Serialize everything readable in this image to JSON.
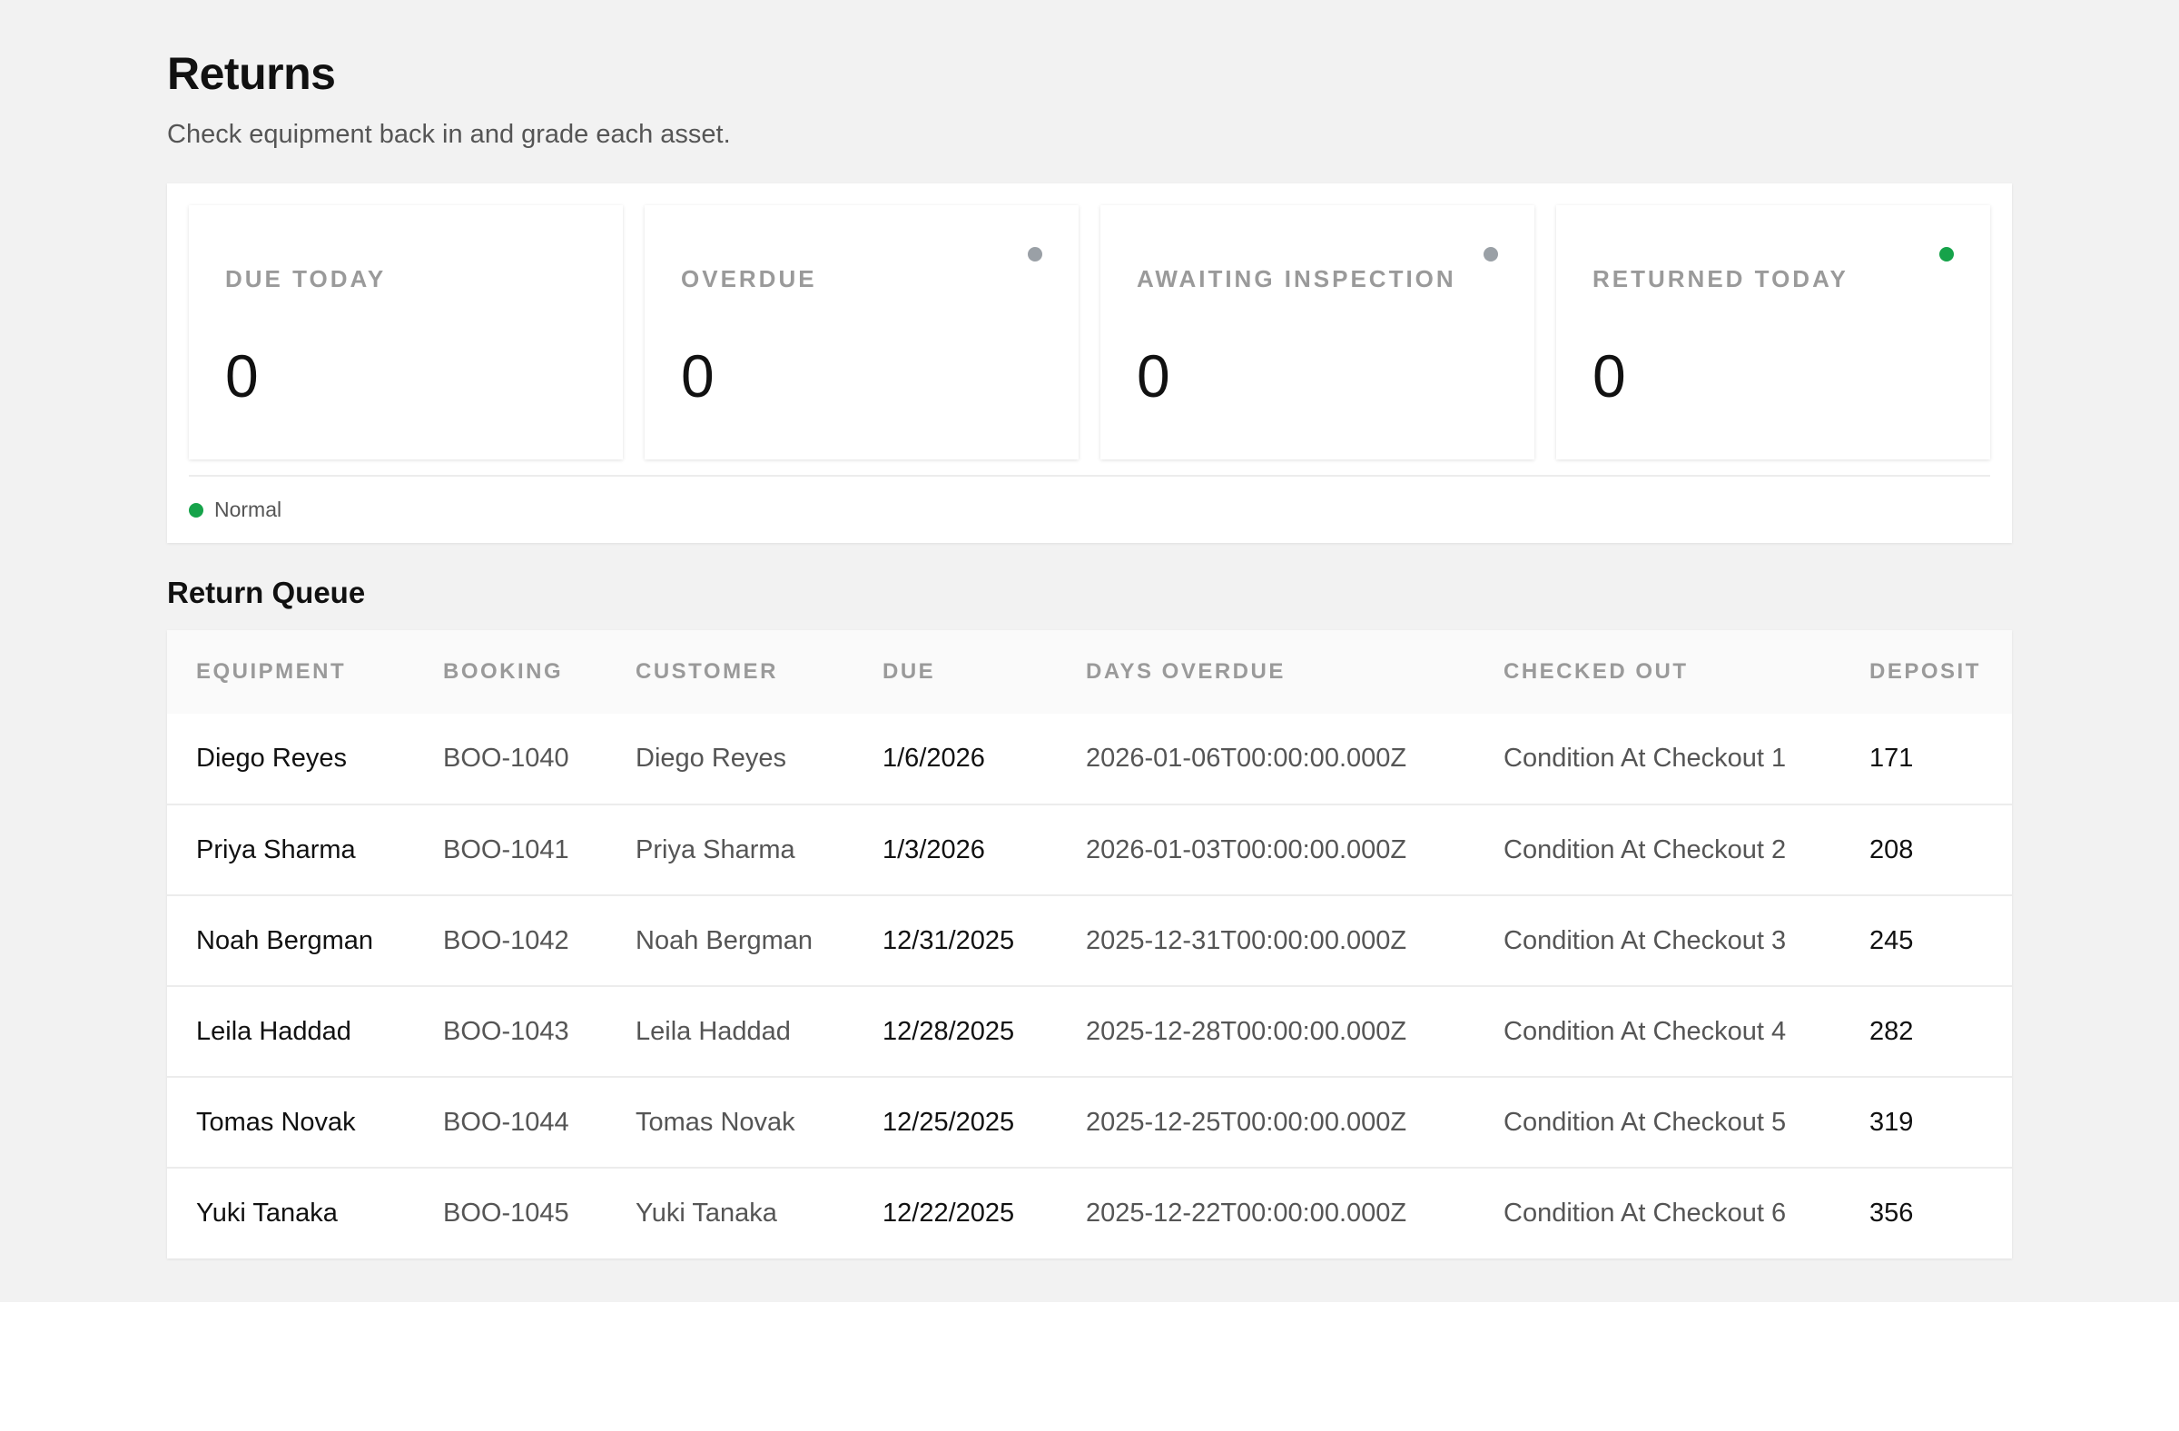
{
  "page": {
    "title": "Returns",
    "subtitle": "Check equipment back in and grade each asset."
  },
  "stats": [
    {
      "label": "DUE TODAY",
      "value": "0",
      "dot": null
    },
    {
      "label": "OVERDUE",
      "value": "0",
      "dot": "#9aa0a6"
    },
    {
      "label": "AWAITING INSPECTION",
      "value": "0",
      "dot": "#9aa0a6"
    },
    {
      "label": "RETURNED TODAY",
      "value": "0",
      "dot": "#16a34a"
    }
  ],
  "legend": {
    "label": "Normal",
    "color": "#16a34a"
  },
  "queue": {
    "title": "Return Queue",
    "columns": [
      "EQUIPMENT",
      "BOOKING",
      "CUSTOMER",
      "DUE",
      "DAYS OVERDUE",
      "CHECKED OUT",
      "DEPOSIT"
    ],
    "rows": [
      [
        "Diego Reyes",
        "BOO-1040",
        "Diego Reyes",
        "1/6/2026",
        "2026-01-06T00:00:00.000Z",
        "Condition At Checkout 1",
        "171"
      ],
      [
        "Priya Sharma",
        "BOO-1041",
        "Priya Sharma",
        "1/3/2026",
        "2026-01-03T00:00:00.000Z",
        "Condition At Checkout 2",
        "208"
      ],
      [
        "Noah Bergman",
        "BOO-1042",
        "Noah Bergman",
        "12/31/2025",
        "2025-12-31T00:00:00.000Z",
        "Condition At Checkout 3",
        "245"
      ],
      [
        "Leila Haddad",
        "BOO-1043",
        "Leila Haddad",
        "12/28/2025",
        "2025-12-28T00:00:00.000Z",
        "Condition At Checkout 4",
        "282"
      ],
      [
        "Tomas Novak",
        "BOO-1044",
        "Tomas Novak",
        "12/25/2025",
        "2025-12-25T00:00:00.000Z",
        "Condition At Checkout 5",
        "319"
      ],
      [
        "Yuki Tanaka",
        "BOO-1045",
        "Yuki Tanaka",
        "12/22/2025",
        "2025-12-22T00:00:00.000Z",
        "Condition At Checkout 6",
        "356"
      ]
    ]
  }
}
